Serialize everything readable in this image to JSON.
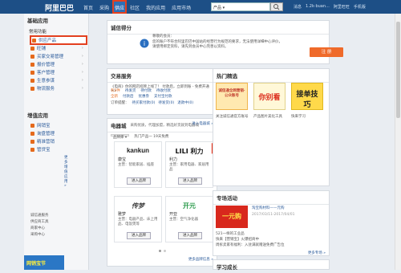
{
  "header": {
    "logo": "阿里巴巴",
    "nav": [
      "首页",
      "采购",
      "供应",
      "社区",
      "我的应用",
      "应用市场"
    ],
    "active_nav": "供应",
    "search_select": "产品 ▾",
    "toplinks": [
      "消息",
      "1.2k·buan...",
      "阿里旺旺",
      "手机版"
    ]
  },
  "sidebar": {
    "section1": "基础应用",
    "subtitle1": "常用功能",
    "items": [
      {
        "label": "供应产品",
        "highlight": true
      },
      {
        "label": "旺铺"
      },
      {
        "label": "买家交易管理"
      },
      {
        "label": "报价管理"
      },
      {
        "label": "客户管理"
      },
      {
        "label": "生意参谋"
      },
      {
        "label": "物流服务"
      }
    ],
    "section2": "增值应用",
    "items2": [
      {
        "label": "网销宝"
      },
      {
        "label": "询盘管理"
      },
      {
        "label": "精准营销"
      },
      {
        "label": "管贷宝"
      }
    ],
    "more": "更多增值应用 »",
    "bottom_links": [
      "诚信通服务",
      "供应商工具",
      "商家中心",
      "采购中心"
    ],
    "promo_text": "网销宝节"
  },
  "main": {
    "credit_title": "诚信得分",
    "notice_greeting": "尊敬的会员：",
    "notice_text": "您的账户不符合阿里巴巴中国站的经营行为规范的要求，无法使用详细中心评价，请使用绑定资料，请先到会员中心完善以资料。",
    "register_button": "注 册",
    "trade_title": "交易服务",
    "trade_line1": "《电商》你的网店招牌上线了！ 付款后，立即到账 - 免费开通 >>",
    "trade_rows": [
      [
        "有3件",
        "待发货",
        "待付款",
        "待收付款"
      ],
      [
        "全新",
        "付款后",
        "优惠券",
        "支付宝付款"
      ]
    ],
    "order_label": "订单提醒：",
    "order_links": [
      "待买家付款(0)",
      "待发货(0)",
      "退款中(0)"
    ],
    "mall_title": "电器城",
    "mall_subtitle": "采购优质，代理加盟，精选好货就到电器城",
    "mall_more": "进入电器城 »",
    "mall_tab": "品牌库 ▾",
    "mall_tab2": "热门产品一 19天免费",
    "brands": [
      {
        "logo": "kankun",
        "name": "康宝",
        "cat": "主营：智能家居、插座"
      },
      {
        "logo": "LILI 利力",
        "name": "利力",
        "cat": "主营：家用电器、家居用品"
      },
      {
        "logo": "传梦",
        "name": "雅梦",
        "cat": "主营：电器产品、床上用品、电饭煲等"
      },
      {
        "logo": "开元",
        "name": "开亚",
        "cat": "主营：空气净化器"
      }
    ],
    "enter_label": "进入品牌",
    "mall_footer": "更多品牌信息 »",
    "figure_label": "图1"
  },
  "right": {
    "hot_title": "热门精选",
    "hot_items": [
      {
        "img_text": "诚信通全网营销·公众账号",
        "caption": "关注诚信通官方账号"
      },
      {
        "img_text": "你别看",
        "caption": "产品图片美化工具"
      },
      {
        "img_text": "接单技巧",
        "caption": "快来学习"
      }
    ],
    "event_title": "专场活动",
    "event_img": "一元购",
    "event_name": "淘宝购材料——元购",
    "event_time": "2017/03/11-2017/04/01",
    "event_lines": [
      "521一样的工业品",
      "快来【营销宝】火爆招商中",
      "周拆卖家有福利：入驻满就赠送免费广告位"
    ],
    "event_more": "更多专场 »",
    "study_title": "学习成长"
  },
  "colors": {
    "brand": "#1d4f86",
    "highlight": "#e3401f",
    "accent": "#ef6a2a"
  }
}
